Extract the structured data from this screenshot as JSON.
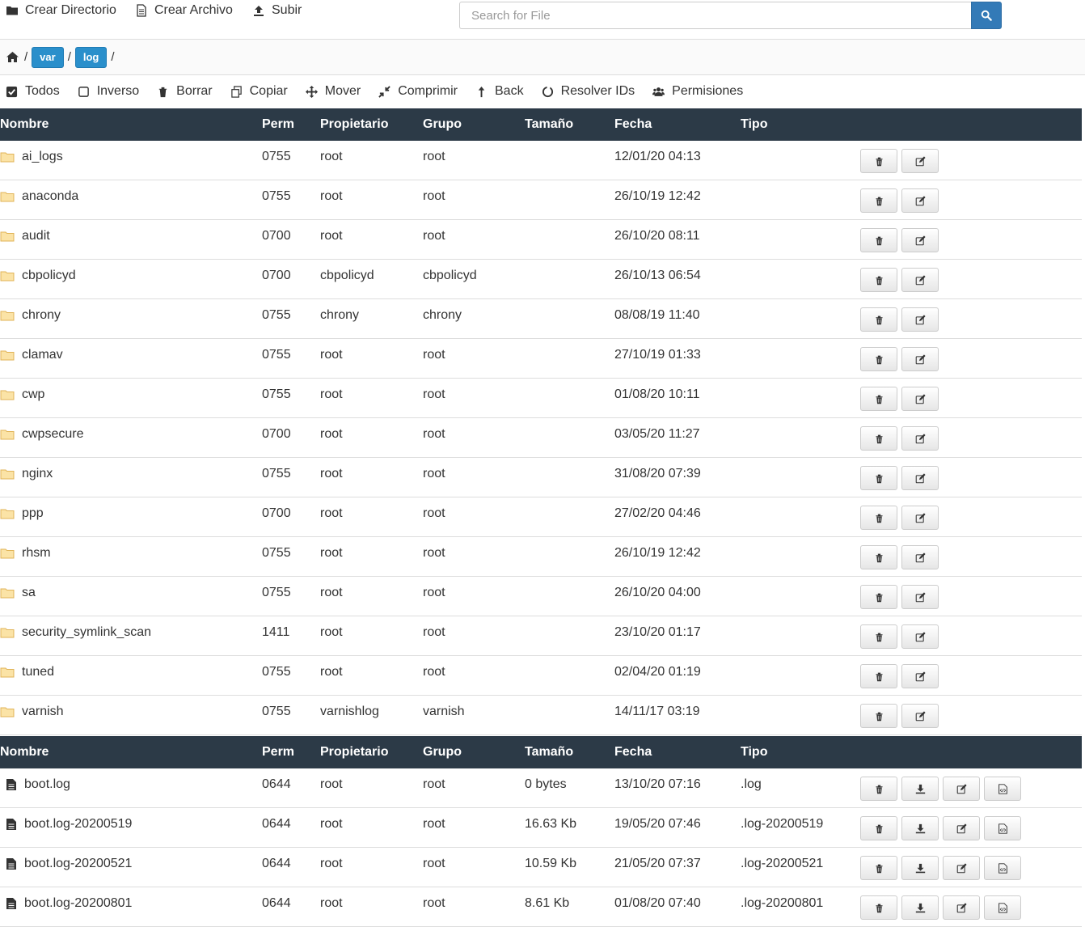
{
  "top_actions": {
    "new_dir": "Crear Directorio",
    "new_file": "Crear Archivo",
    "upload": "Subir"
  },
  "search": {
    "placeholder": "Search for File"
  },
  "breadcrumb": {
    "separator": "/",
    "items": [
      "var",
      "log"
    ]
  },
  "toolbar": {
    "all": "Todos",
    "inverse": "Inverso",
    "delete": "Borrar",
    "copy": "Copiar",
    "move": "Mover",
    "compress": "Comprimir",
    "back": "Back",
    "resolve": "Resolver IDs",
    "perms": "Permisiones"
  },
  "columns": {
    "name": "Nombre",
    "perm": "Perm",
    "owner": "Propietario",
    "group": "Grupo",
    "size": "Tamaño",
    "date": "Fecha",
    "type": "Tipo"
  },
  "directories": [
    {
      "name": "ai_logs",
      "perm": "0755",
      "owner": "root",
      "group": "root",
      "date": "12/01/20 04:13"
    },
    {
      "name": "anaconda",
      "perm": "0755",
      "owner": "root",
      "group": "root",
      "date": "26/10/19 12:42"
    },
    {
      "name": "audit",
      "perm": "0700",
      "owner": "root",
      "group": "root",
      "date": "26/10/20 08:11"
    },
    {
      "name": "cbpolicyd",
      "perm": "0700",
      "owner": "cbpolicyd",
      "group": "cbpolicyd",
      "date": "26/10/13 06:54"
    },
    {
      "name": "chrony",
      "perm": "0755",
      "owner": "chrony",
      "group": "chrony",
      "date": "08/08/19 11:40"
    },
    {
      "name": "clamav",
      "perm": "0755",
      "owner": "root",
      "group": "root",
      "date": "27/10/19 01:33"
    },
    {
      "name": "cwp",
      "perm": "0755",
      "owner": "root",
      "group": "root",
      "date": "01/08/20 10:11"
    },
    {
      "name": "cwpsecure",
      "perm": "0700",
      "owner": "root",
      "group": "root",
      "date": "03/05/20 11:27"
    },
    {
      "name": "nginx",
      "perm": "0755",
      "owner": "root",
      "group": "root",
      "date": "31/08/20 07:39"
    },
    {
      "name": "ppp",
      "perm": "0700",
      "owner": "root",
      "group": "root",
      "date": "27/02/20 04:46"
    },
    {
      "name": "rhsm",
      "perm": "0755",
      "owner": "root",
      "group": "root",
      "date": "26/10/19 12:42"
    },
    {
      "name": "sa",
      "perm": "0755",
      "owner": "root",
      "group": "root",
      "date": "26/10/20 04:00"
    },
    {
      "name": "security_symlink_scan",
      "perm": "1411",
      "owner": "root",
      "group": "root",
      "date": "23/10/20 01:17"
    },
    {
      "name": "tuned",
      "perm": "0755",
      "owner": "root",
      "group": "root",
      "date": "02/04/20 01:19"
    },
    {
      "name": "varnish",
      "perm": "0755",
      "owner": "varnishlog",
      "group": "varnish",
      "date": "14/11/17 03:19"
    }
  ],
  "files": [
    {
      "name": "boot.log",
      "perm": "0644",
      "owner": "root",
      "group": "root",
      "size": "0 bytes",
      "date": "13/10/20 07:16",
      "type": ".log"
    },
    {
      "name": "boot.log-20200519",
      "perm": "0644",
      "owner": "root",
      "group": "root",
      "size": "16.63 Kb",
      "date": "19/05/20 07:46",
      "type": ".log-20200519"
    },
    {
      "name": "boot.log-20200521",
      "perm": "0644",
      "owner": "root",
      "group": "root",
      "size": "10.59 Kb",
      "date": "21/05/20 07:37",
      "type": ".log-20200521"
    },
    {
      "name": "boot.log-20200801",
      "perm": "0644",
      "owner": "root",
      "group": "root",
      "size": "8.61 Kb",
      "date": "01/08/20 07:40",
      "type": ".log-20200801"
    }
  ],
  "colors": {
    "header_bg": "#2c3a47",
    "accent": "#337ab7",
    "breadcrumb_btn": "#2a8fcb",
    "folder": "#f0c36d"
  }
}
